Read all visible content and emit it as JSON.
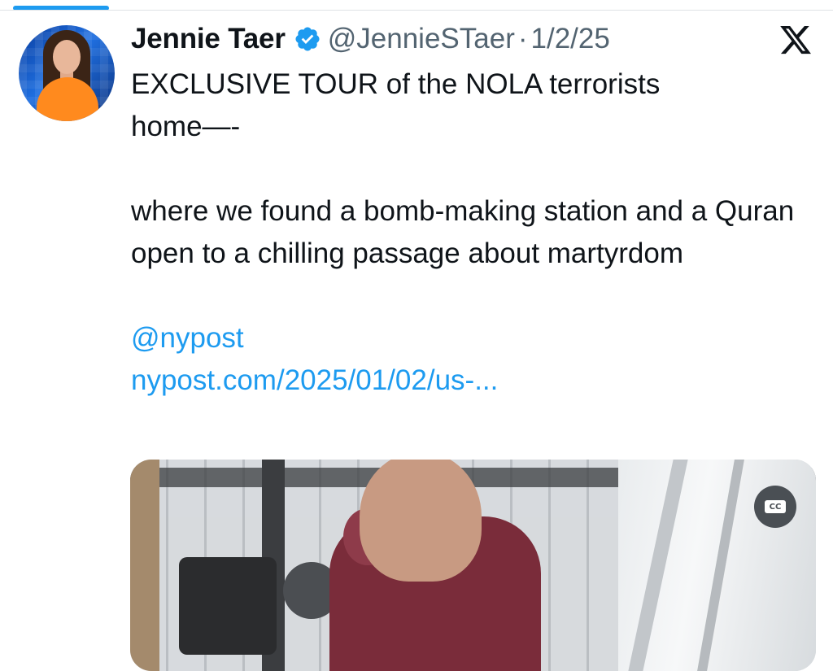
{
  "tweet": {
    "author_name": "Jennie Taer",
    "handle": "@JennieSTaer",
    "separator": "·",
    "date": "1/2/25",
    "verified": true,
    "text_line1": "EXCLUSIVE TOUR of the NOLA terrorists",
    "text_line2": "home—-",
    "text_para2": "where we found a bomb-making station and a Quran open to a chilling passage about martyrdom",
    "mention": "@nypost",
    "link": "nypost.com/2025/01/02/us-..."
  },
  "media": {
    "cc_label": "CC"
  },
  "colors": {
    "accent": "#1d9bf0",
    "text": "#0f1419",
    "muted": "#536471"
  },
  "icons": {
    "verified": "verified-badge-icon",
    "platform": "x-logo-icon",
    "captions": "closed-captions-icon"
  }
}
